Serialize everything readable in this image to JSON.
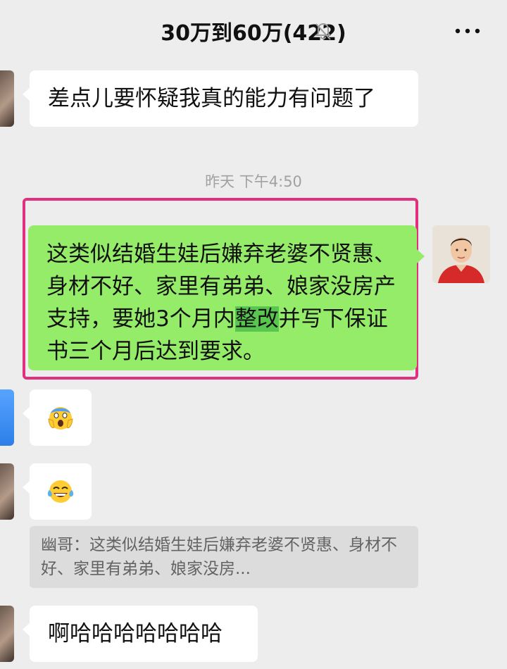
{
  "header": {
    "title": "30万到60万(422)",
    "mute_icon": "bell-off-icon",
    "more_icon": "more-dots-icon"
  },
  "messages": [
    {
      "side": "left",
      "text": "差点儿要怀疑我真的能力有问题了"
    },
    {
      "type": "time",
      "text": "昨天 下午4:50"
    },
    {
      "side": "right",
      "text_part1": "这类似结婚生娃后嫌弃老婆不贤惠、身材不好、家里有弟弟、娘家没房产支持，要她3个月内",
      "highlight": "整改",
      "text_part2": "并写下保证书三个月后达到要求。"
    },
    {
      "side": "left",
      "emoji": "screaming-face-emoji"
    },
    {
      "side": "left",
      "emoji": "tears-of-joy-emoji"
    },
    {
      "type": "quote",
      "text": "幽哥：这类似结婚生娃后嫌弃老婆不贤惠、身材不好、家里有弟弟、娘家没房..."
    },
    {
      "side": "left",
      "text": "啊哈哈哈哈哈哈哈"
    }
  ],
  "colors": {
    "background": "#ededed",
    "own_bubble": "#95ec69",
    "other_bubble": "#ffffff",
    "highlight_border": "#e0307e",
    "quote_background": "#dcdcdc"
  }
}
